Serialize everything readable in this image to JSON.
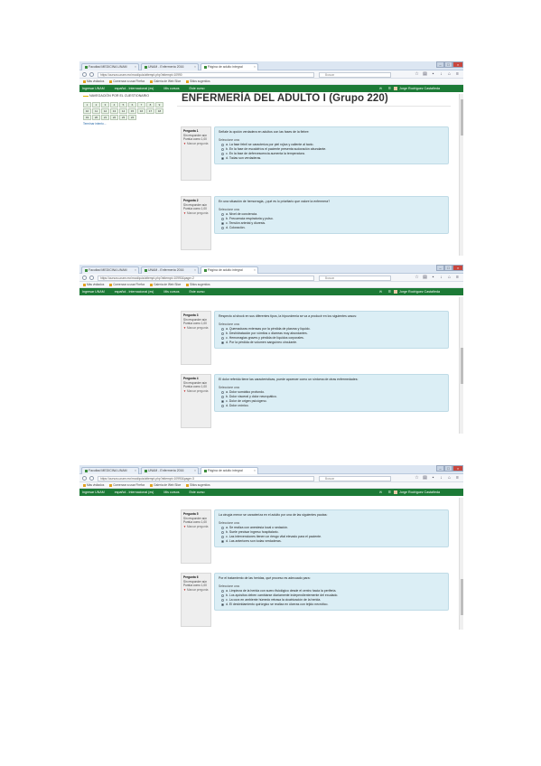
{
  "shots": [
    {
      "tabs": [
        "Facultad MEDICINA UNAM",
        "UNAM - Enfermería 2016",
        "Página de adulto integral"
      ],
      "url": "https://cursos.unam.mx/mod/quiz/attempt.php?attempt=10990",
      "search_placeholder": "Buscar",
      "bookmarks": [
        "Más visitados",
        "Comenzar a usar Firefox",
        "Galería de Web Slice",
        "Sitios sugeridos"
      ],
      "site_menu": [
        "Ingresar UNAM",
        "español - Internacional (es)",
        "Mis cursos",
        "Este curso"
      ],
      "user": "Jorge Rodríguez Castañeda",
      "nav_title": "NAVEGACIÓN POR EL CUESTIONARIO",
      "nav_buttons": [
        "1",
        "2",
        "3",
        "4",
        "5",
        "6",
        "7",
        "8",
        "9",
        "10",
        "11",
        "12",
        "13",
        "14",
        "15",
        "16",
        "17",
        "18",
        "19",
        "20",
        "21",
        "22",
        "23",
        "24"
      ],
      "nav_finish": "Terminar intento...",
      "course_title": "ENFERMERÍA DEL ADULTO I (Grupo 220)",
      "questions": [
        {
          "number": "Pregunta 1",
          "status": "Sin responder aún",
          "points": "Puntúa como 1,00",
          "flag": "Marcar pregunta",
          "text": "Señale la opción verdadera en adultos con las fases de la fiebre:",
          "select": "Seleccione una:",
          "options": [
            "a. La fase febril se caracteriza por piel rojiza y caliente al tacto.",
            "b. En la fase de escalofríos el paciente presenta sudoración abundante.",
            "c. En la fase de defervescencia aumenta la temperatura.",
            "d. Todas son verdaderas."
          ],
          "selected": 3
        },
        {
          "number": "Pregunta 2",
          "status": "Sin responder aún",
          "points": "Puntúa como 1,00",
          "flag": "Marcar pregunta",
          "text": "En una situación de hemorragia, ¿qué es lo prioritario que valore la enfermera?",
          "select": "Seleccione una:",
          "options": [
            "a. Nivel de conciencia.",
            "b. Frecuencia respiratoria y pulso.",
            "c. Tensión arterial y diuresis.",
            "d. Coloración."
          ],
          "selected": 2
        }
      ]
    },
    {
      "tabs": [
        "Facultad MEDICINA UNAM",
        "UNAM - Enfermería 2016",
        "Página de adulto integral"
      ],
      "url": "https://cursos.unam.mx/mod/quiz/attempt.php?attempt=10990&page=2",
      "search_placeholder": "Buscar",
      "bookmarks": [
        "Más visitados",
        "Comenzar a usar Firefox",
        "Galería de Web Slice",
        "Sitios sugeridos"
      ],
      "site_menu": [
        "Ingresar UNAM",
        "español - Internacional (es)",
        "Mis cursos",
        "Este curso"
      ],
      "user": "Jorge Rodríguez Castañeda",
      "questions": [
        {
          "number": "Pregunta 3",
          "status": "Sin responder aún",
          "points": "Puntúa como 1,00",
          "flag": "Marcar pregunta",
          "text": "Respecto al shock en sus diferentes tipos, la hipovolemia se va a producir en los siguientes casos:",
          "select": "Seleccione una:",
          "options": [
            "a. Quemaduras extensas por la pérdida de plasma y líquido.",
            "b. Deshidratación por vómitos o diarreas muy abundantes.",
            "c. Hemorragias graves y pérdida de líquidos corporales.",
            "d. Por la pérdida de volumen sanguíneo circulante."
          ],
          "selected": 3
        },
        {
          "number": "Pregunta 4",
          "status": "Sin responder aún",
          "points": "Puntúa como 1,00",
          "flag": "Marcar pregunta",
          "text": "El dolor referido tiene las características, puede aparecer como un síntoma de otras enfermedades:",
          "select": "Seleccione una:",
          "options": [
            "a. Dolor somático profundo.",
            "b. Dolor visceral y dolor neuropático.",
            "c. Dolor de origen psicógeno.",
            "d. Dolor crónico."
          ],
          "selected": 2
        }
      ]
    },
    {
      "tabs": [
        "Facultad MEDICINA UNAM",
        "UNAM - Enfermería 2016",
        "Página de adulto integral"
      ],
      "url": "https://cursos.unam.mx/mod/quiz/attempt.php?attempt=10990&page=3",
      "search_placeholder": "Buscar",
      "bookmarks": [
        "Más visitados",
        "Comenzar a usar Firefox",
        "Galería de Web Slice",
        "Sitios sugeridos"
      ],
      "site_menu": [
        "Ingresar UNAM",
        "español - Internacional (es)",
        "Mis cursos",
        "Este curso"
      ],
      "user": "Jorge Rodríguez Castañeda",
      "questions": [
        {
          "number": "Pregunta 5",
          "status": "Sin responder aún",
          "points": "Puntúa como 1,00",
          "flag": "Marcar pregunta",
          "text": "La cirugía menor se caracteriza en el adulto por una de las siguientes pautas:",
          "select": "Seleccione una:",
          "options": [
            "a. Se realiza con anestesia local o sedación.",
            "b. Suele precisar ingreso hospitalario.",
            "c. Las intervenciones tienen un riesgo vital elevado para el paciente.",
            "d. Las anteriores son todas verdaderas."
          ],
          "selected": 3
        },
        {
          "number": "Pregunta 6",
          "status": "Sin responder aún",
          "points": "Puntúa como 1,00",
          "flag": "Marcar pregunta",
          "text": "Por el tratamiento de las heridas, qué proceso es adecuado para:",
          "select": "Seleccione una:",
          "options": [
            "a. Limpieza de la herida con suero fisiológico desde el centro hacia la periferia.",
            "b. Los apósitos deben cambiarse diariamente independientemente del exudado.",
            "c. La cura en ambiente húmedo retrasa la cicatrización de la herida.",
            "d. El desbridamiento quirúrgico se realiza en úlceras con tejido necrótico."
          ],
          "selected": 3
        }
      ]
    }
  ]
}
